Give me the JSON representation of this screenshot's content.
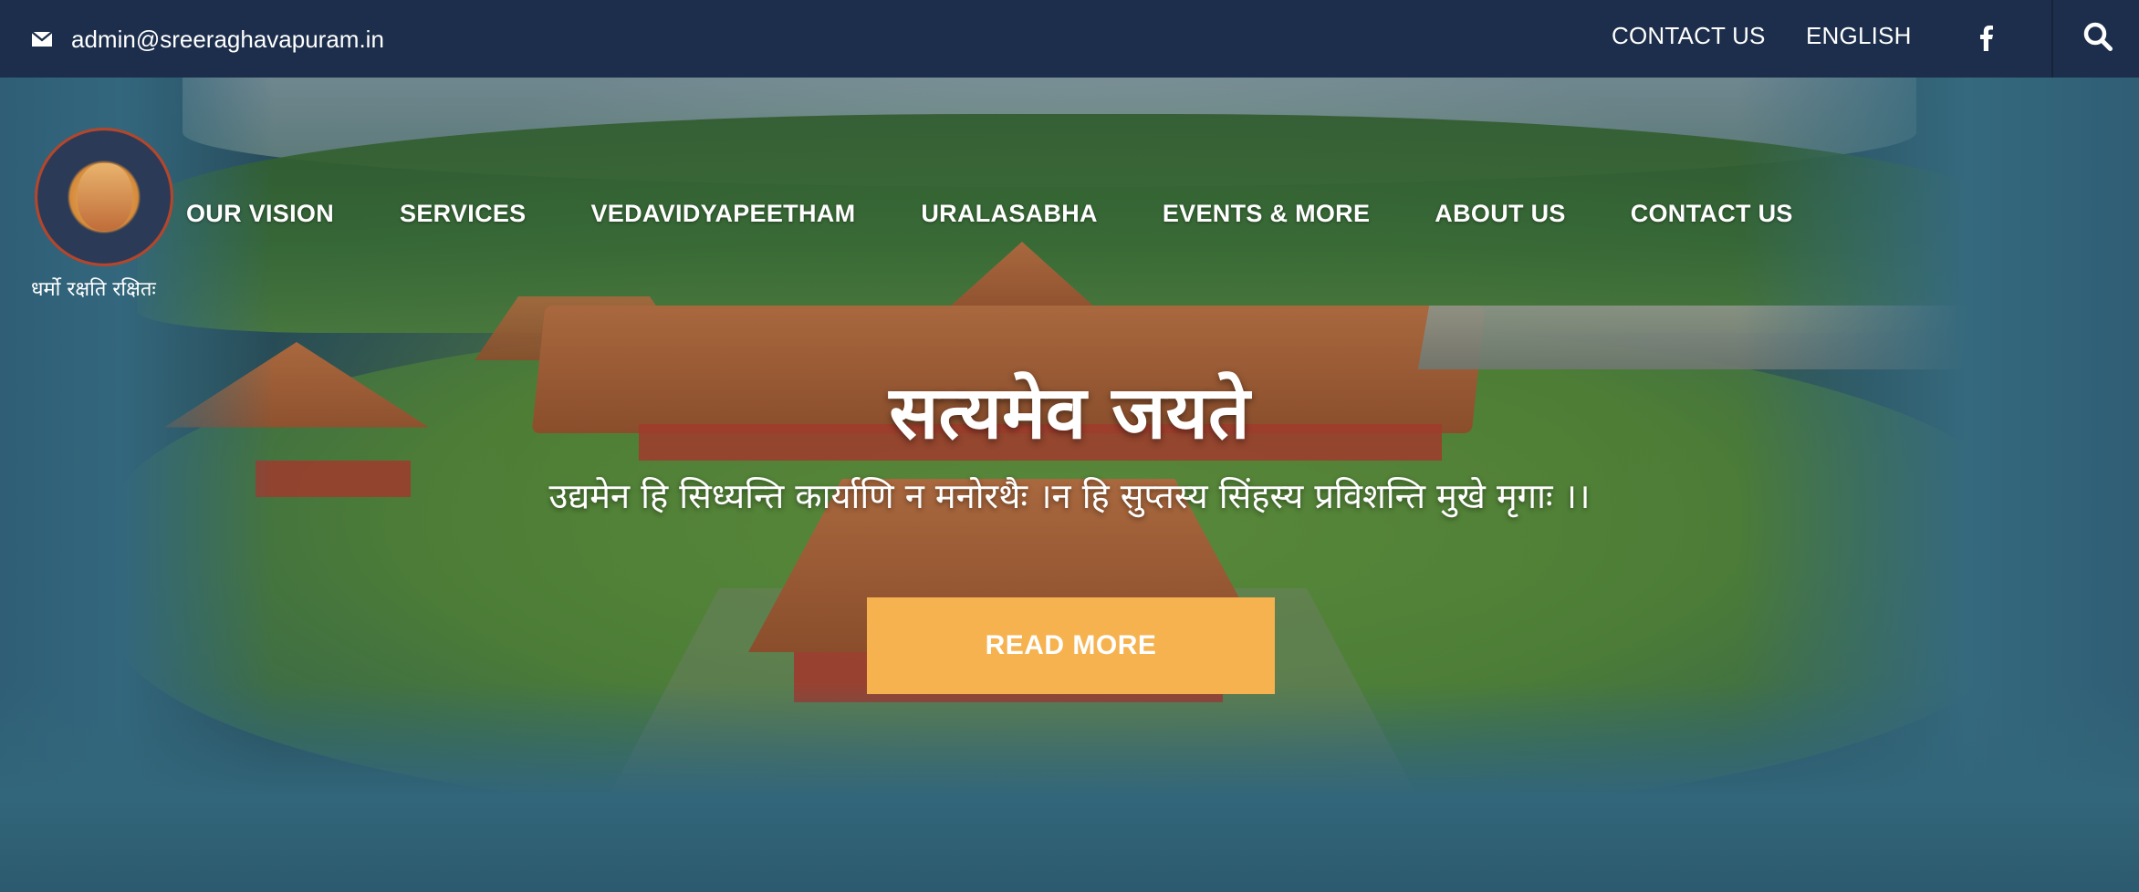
{
  "topbar": {
    "email": "admin@sreeraghavapuram.in",
    "contact_label": "CONTACT US",
    "language_label": "ENGLISH",
    "mail_icon": "envelope-icon",
    "facebook_icon": "facebook-icon",
    "search_icon": "search-icon"
  },
  "brand": {
    "tagline": "धर्मो रक्षति रक्षितः"
  },
  "nav": {
    "items": [
      {
        "label": "OUR VISION"
      },
      {
        "label": "SERVICES"
      },
      {
        "label": "VEDAVIDYAPEETHAM"
      },
      {
        "label": "URALASABHA"
      },
      {
        "label": "EVENTS & MORE"
      },
      {
        "label": "ABOUT US"
      },
      {
        "label": "CONTACT US"
      }
    ]
  },
  "hero": {
    "title": "सत्यमेव जयते",
    "subtitle": "उद्यमेन हि सिध्यन्ति कार्याणि न मनोरथैः ।न हि सुप्तस्य सिंहस्य प्रविशन्ति मुखे मृगाः ।।",
    "button_label": "READ MORE"
  },
  "colors": {
    "topbar_bg": "#1c2e4b",
    "button_bg": "#f6b24f",
    "text": "#ffffff"
  }
}
